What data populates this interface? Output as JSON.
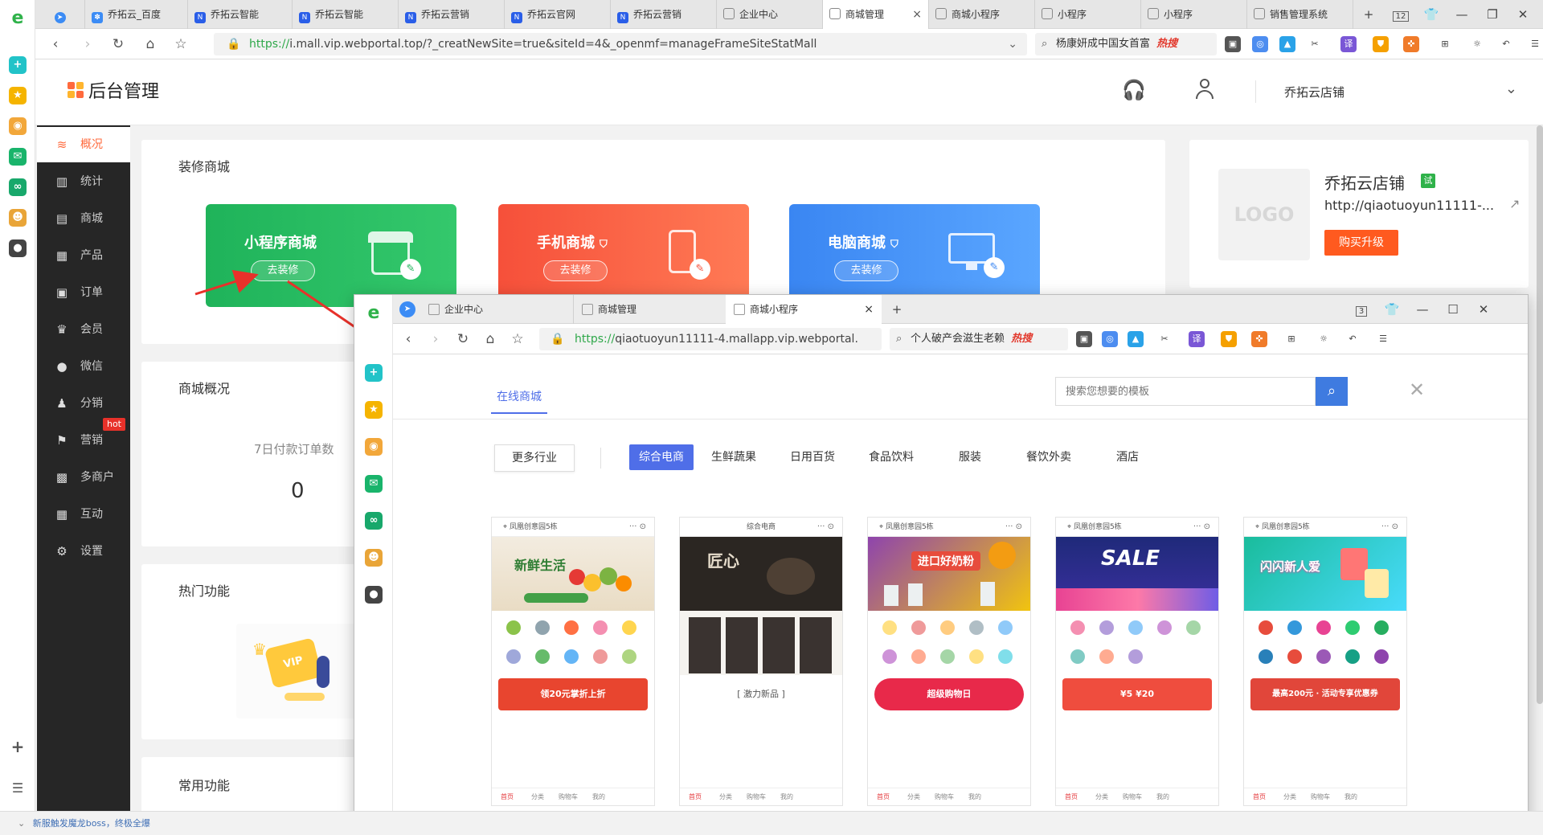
{
  "browser": {
    "tabs": [
      {
        "label": "乔拓云_百度",
        "icon_color": "#3c8cf5"
      },
      {
        "label": "乔拓云智能",
        "icon_color": "#2a5ee8"
      },
      {
        "label": "乔拓云智能",
        "icon_color": "#2a5ee8"
      },
      {
        "label": "乔拓云营销",
        "icon_color": "#2a5ee8"
      },
      {
        "label": "乔拓云官网",
        "icon_color": "#2a5ee8"
      },
      {
        "label": "乔拓云营销",
        "icon_color": "#2a5ee8"
      },
      {
        "label": "企业中心",
        "icon_color": "#999999"
      },
      {
        "label": "商城管理",
        "icon_color": "#999999",
        "active": true
      },
      {
        "label": "商城小程序",
        "icon_color": "#999999"
      },
      {
        "label": "小程序",
        "icon_color": "#999999"
      },
      {
        "label": "小程序",
        "icon_color": "#999999"
      },
      {
        "label": "销售管理系统",
        "icon_color": "#999999"
      }
    ],
    "tab_count": "12",
    "url_scheme": "https://",
    "url_rest": "i.mall.vip.webportal.top/?_creatNewSite=true&siteId=4&_openmf=manageFrameSiteStatMall",
    "search_hot": "杨康妍成中国女首富",
    "hot_tag": "热搜"
  },
  "admin": {
    "brand": "后台管理",
    "shop_name": "乔拓云店铺",
    "menu": [
      {
        "label": "概况",
        "icon": "layers-icon",
        "active": true
      },
      {
        "label": "统计",
        "icon": "chart-icon"
      },
      {
        "label": "商城",
        "icon": "shop-icon"
      },
      {
        "label": "产品",
        "icon": "grid-icon"
      },
      {
        "label": "订单",
        "icon": "order-icon"
      },
      {
        "label": "会员",
        "icon": "crown-icon"
      },
      {
        "label": "微信",
        "icon": "chat-icon"
      },
      {
        "label": "分销",
        "icon": "users-icon"
      },
      {
        "label": "营销",
        "icon": "flag-icon",
        "badge": "hot"
      },
      {
        "label": "多商户",
        "icon": "store-icon"
      },
      {
        "label": "互动",
        "icon": "apps-icon"
      },
      {
        "label": "设置",
        "icon": "gear-icon"
      }
    ],
    "decorate_title": "装修商城",
    "tiles": [
      {
        "title": "小程序商城",
        "button": "去装修",
        "color": "#22b85a"
      },
      {
        "title": "手机商城",
        "button": "去装修",
        "color": "#fa5a3a"
      },
      {
        "title": "电脑商城",
        "button": "去装修",
        "color": "#3d8ef5"
      }
    ],
    "overview_title": "商城概况",
    "stat_label": "7日付款订单数",
    "stat_value": "0",
    "hot_title": "热门功能",
    "common_title": "常用功能",
    "logo_placeholder": "LOGO",
    "trial_badge": "试",
    "shop_url": "http://qiaotuoyun11111-...",
    "upgrade_button": "购买升级"
  },
  "popup": {
    "tabs": [
      "企业中心",
      "商城管理",
      "商城小程序"
    ],
    "tab_count": "3",
    "url_scheme": "https://",
    "url_rest": "qiaotuoyun11111-4.mallapp.vip.webportal.",
    "search_hot": "个人破产会滋生老赖",
    "hot_tag": "热搜",
    "section_tab": "在线商城",
    "search_placeholder": "搜索您想要的模板",
    "more_industry": "更多行业",
    "categories": [
      "综合电商",
      "生鲜蔬果",
      "日用百货",
      "食品饮料",
      "服装",
      "餐饮外卖",
      "酒店"
    ],
    "templates": [
      {
        "header": "凤凰创意园5栋",
        "banner": "新鲜生活",
        "promo": "领20元掌折上折",
        "promo_color": "#e8452f"
      },
      {
        "header": "综合电商",
        "banner": "匠心",
        "promo": "[ 激力新品 ]",
        "promo_color": "#3a3a3a"
      },
      {
        "header": "凤凰创意园5栋",
        "banner": "进口好奶粉",
        "promo": "超级购物日",
        "promo_color": "#e8294a"
      },
      {
        "header": "凤凰创意园5栋",
        "banner": "SALE",
        "promo": "¥5  ¥20",
        "promo_color": "#ef4d3e"
      },
      {
        "header": "凤凰创意园5栋",
        "banner": "闪闪新人爱",
        "promo": "最高200元 · 活动专享优惠券",
        "promo_color": "#e1463a"
      }
    ],
    "footer_labels": [
      "首页",
      "分类",
      "购物车",
      "我的"
    ]
  },
  "status_bar": "新服触发魔龙boss，终极全爆"
}
